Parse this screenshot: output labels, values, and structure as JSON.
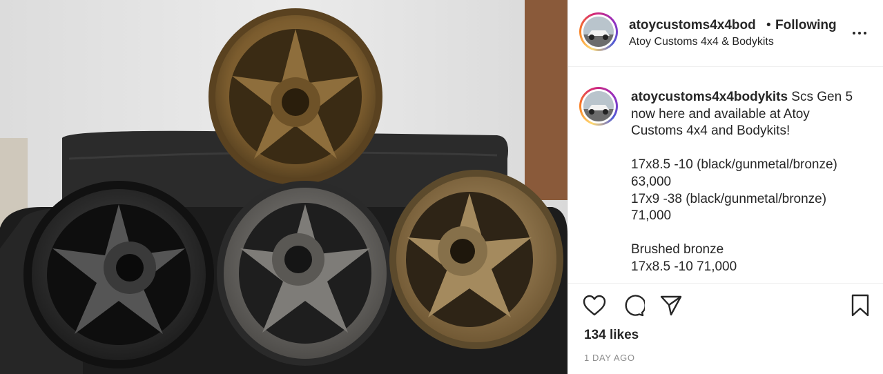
{
  "post": {
    "username": "atoycustoms4x4bod",
    "separator": "•",
    "follow_status": "Following",
    "location": "Atoy Customs 4x4 & Bodykits",
    "image_alt": "Five-spoke wheels in bronze, black, gunmetal and brushed bronze finishes stacked on a black leather couch"
  },
  "caption": {
    "username": "atoycustoms4x4bodykits",
    "text": " Scs Gen 5\nnow here and available at Atoy\nCustoms 4x4 and Bodykits!\n\n17x8.5 -10 (black/gunmetal/bronze)\n63,000\n17x9 -38 (black/gunmetal/bronze)\n71,000\n\nBrushed bronze\n17x8.5 -10 71,000"
  },
  "stats": {
    "likes": "134 likes",
    "timestamp": "1 DAY AGO"
  },
  "icons": {
    "more": "more-options-icon",
    "like": "heart-icon",
    "comment": "comment-icon",
    "share": "paper-plane-icon",
    "save": "bookmark-icon"
  },
  "colors": {
    "text": "#262626",
    "muted": "#8e8e8e",
    "border": "#efefef",
    "bronze": "#8a6a3a",
    "black_wheel": "#2a2a2a",
    "gunmetal": "#6a6864",
    "brushed_bronze": "#9c8258"
  }
}
